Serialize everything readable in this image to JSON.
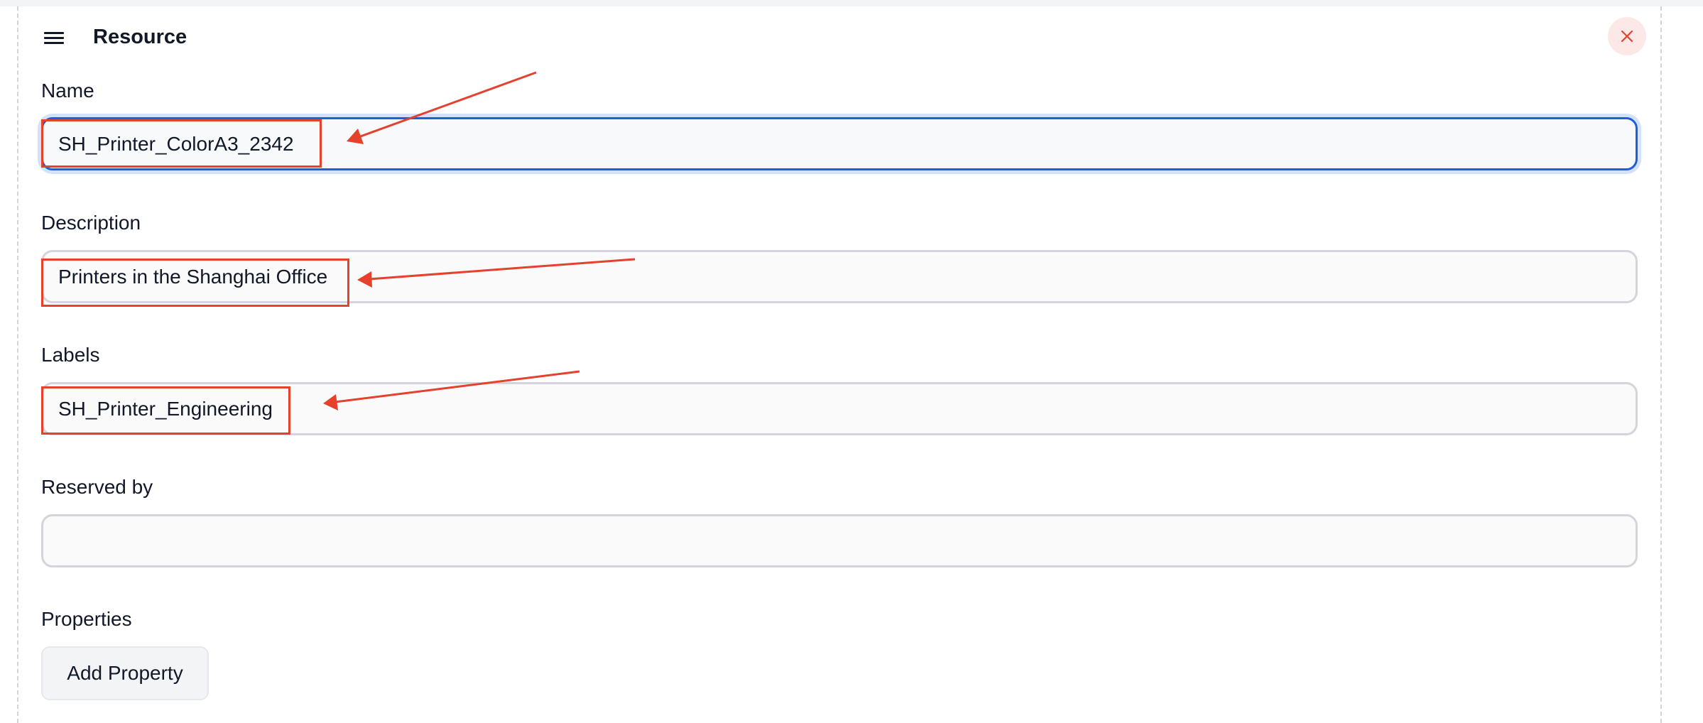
{
  "header": {
    "title": "Resource",
    "menu_icon": "hamburger-menu-icon",
    "close_icon": "close-icon",
    "close_color": "#e5412c"
  },
  "form": {
    "name": {
      "label": "Name",
      "value": "SH_Printer_ColorA3_2342"
    },
    "description": {
      "label": "Description",
      "value": "Printers in the Shanghai Office"
    },
    "labels": {
      "label": "Labels",
      "value": "SH_Printer_Engineering"
    },
    "reserved_by": {
      "label": "Reserved by",
      "value": ""
    },
    "properties": {
      "label": "Properties",
      "add_button": "Add Property"
    }
  },
  "colors": {
    "accent": "#1d5fd6",
    "annotation": "#e5412c"
  }
}
